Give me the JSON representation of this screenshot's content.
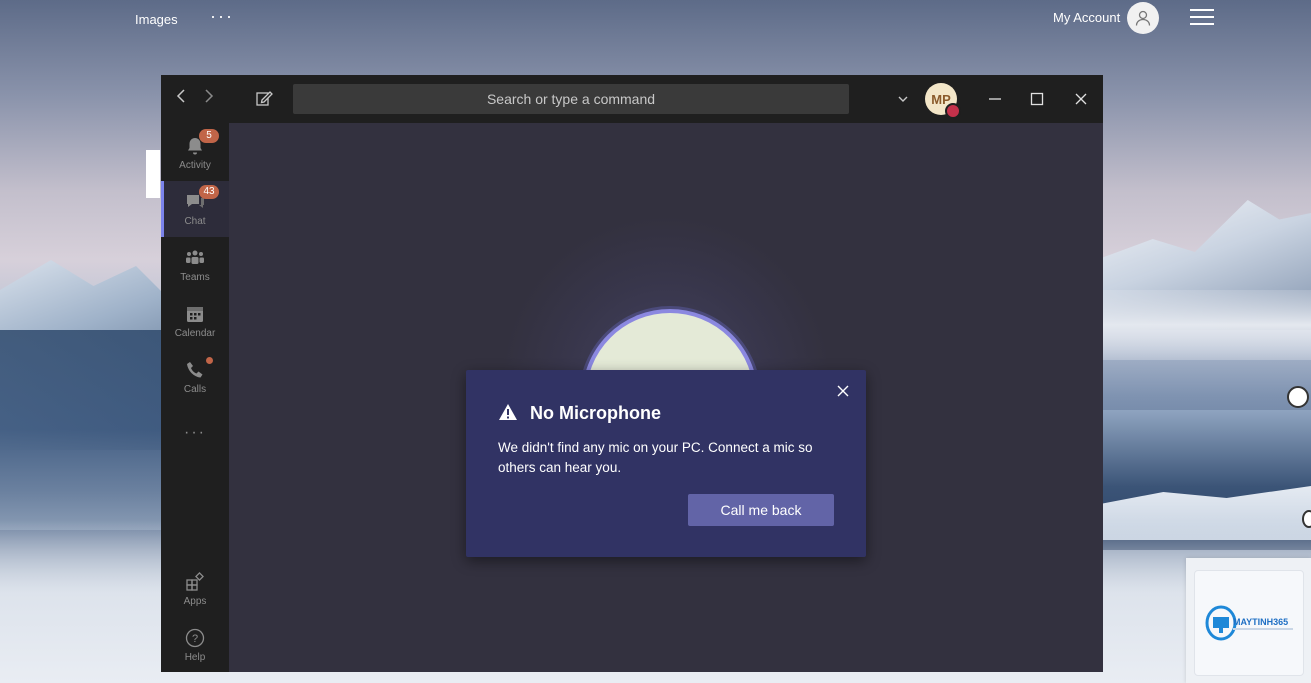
{
  "browser": {
    "images_label": "Images",
    "more_label": "···",
    "account_label": "My Account"
  },
  "teams": {
    "search_placeholder": "Search or type a command",
    "user_initials": "MP",
    "rail": [
      {
        "label": "Activity",
        "badge": "5"
      },
      {
        "label": "Chat",
        "badge": "43"
      },
      {
        "label": "Teams"
      },
      {
        "label": "Calendar"
      },
      {
        "label": "Calls"
      },
      {
        "label": "···"
      },
      {
        "label": "Apps"
      },
      {
        "label": "Help"
      }
    ]
  },
  "dialog": {
    "title": "No Microphone",
    "body": "We didn't find any mic on your PC. Connect a mic so others can hear you.",
    "button_label": "Call me back"
  },
  "colors": {
    "accent": "#6264a7",
    "dialog_bg": "#313364",
    "badge": "#c16548",
    "presence_busy": "#c4314b"
  },
  "logo": {
    "text": "MAYTINH365"
  }
}
